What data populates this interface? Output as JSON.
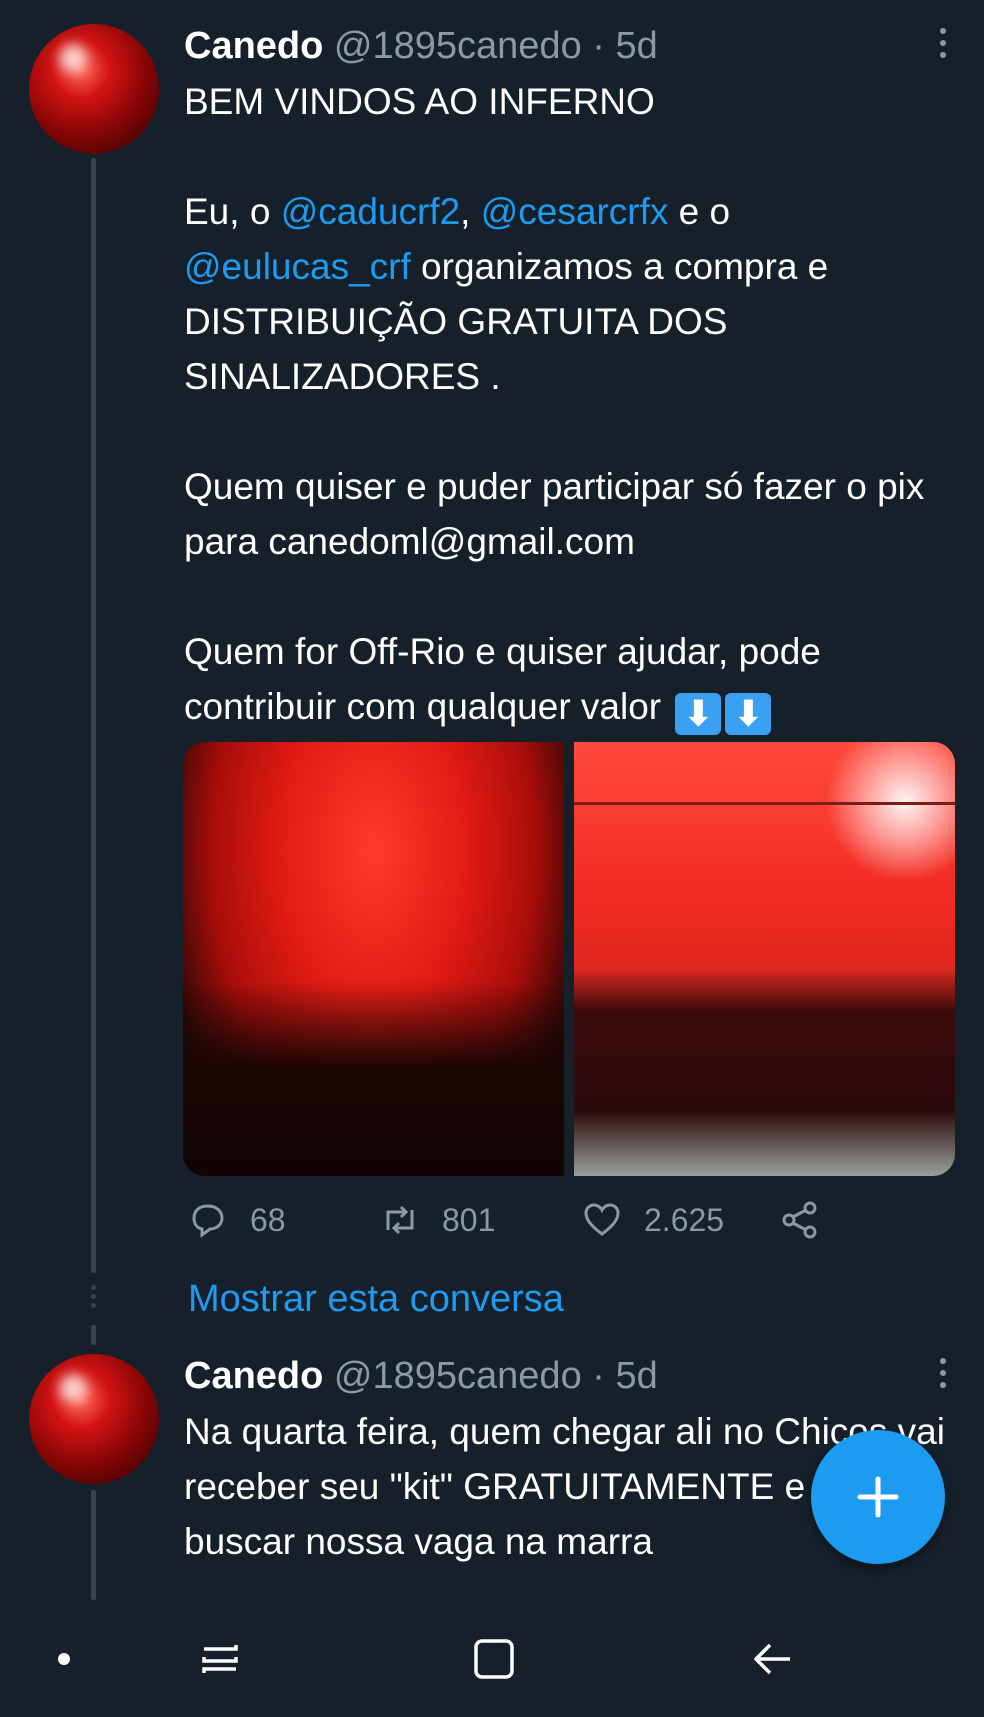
{
  "tweet1": {
    "name": "Canedo",
    "handle": "@1895canedo",
    "time": "· 5d",
    "line1": "BEM VINDOS AO INFERNO",
    "p2_pre": "Eu, o ",
    "mention1": "@caducrf2",
    "p2_sep": ", ",
    "mention2": "@cesarcrfx",
    "p2_mid": " e o",
    "mention3": "@eulucas_crf",
    "p2_post": " organizamos a compra e DISTRIBUIÇÃO GRATUITA DOS SINALIZADORES .",
    "p3": "Quem quiser e puder participar só fazer o pix para canedoml@gmail.com",
    "p4": "Quem for Off-Rio e quiser ajudar, pode contribuir com qualquer valor",
    "emoji": "⬇",
    "replies": "68",
    "retweets": "801",
    "likes": "2.625"
  },
  "show_thread": "Mostrar esta conversa",
  "tweet2": {
    "name": "Canedo",
    "handle": "@1895canedo",
    "time": "· 5d",
    "text": "Na quarta feira, quem chegar ali no Chicos vai receber seu \"kit\" GRATUITAMENTE e vamos buscar nossa vaga na marra"
  },
  "icons": {
    "reply": "reply-icon",
    "retweet": "retweet-icon",
    "like": "heart-icon",
    "share": "share-icon",
    "compose": "plus-icon"
  },
  "colors": {
    "background": "#15202b",
    "accent": "#1d9bf0",
    "muted": "#8b98a5"
  }
}
